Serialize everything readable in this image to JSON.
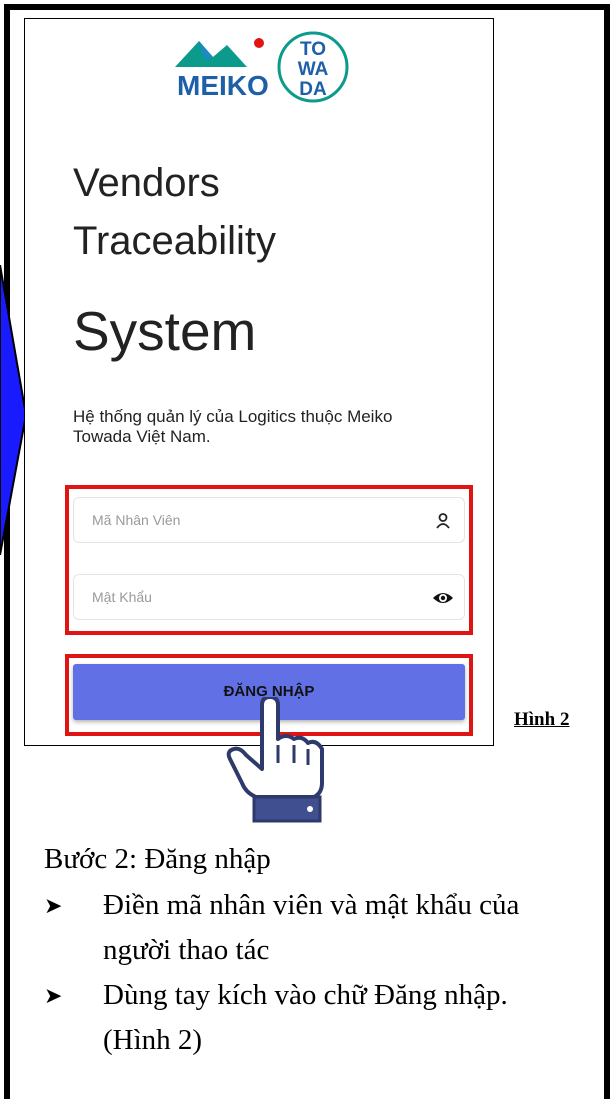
{
  "logo": {
    "brand_text": "MEIKO",
    "circle_text": [
      "TO",
      "WA",
      "DA"
    ]
  },
  "app": {
    "title_line1": "Vendors",
    "title_line2": "Traceability",
    "title_line3": "System",
    "description": "Hệ thống quản lý của Logitics thuộc Meiko Towada Việt Nam."
  },
  "form": {
    "employee_id_placeholder": "Mã Nhân Viên",
    "password_placeholder": "Mật Khẩu",
    "login_label": "ĐĂNG NHẬP"
  },
  "icons": {
    "user": "user-icon",
    "eye": "eye-icon",
    "hand": "pointing-hand-icon",
    "arrow": "arrow-icon"
  },
  "colors": {
    "button": "#6270e6",
    "highlight": "#e11414",
    "arrow": "#1a1aff"
  },
  "figure_label": "Hình 2",
  "instructions": {
    "step_title": "Bước 2: Đăng nhập",
    "bullets": [
      "Điền mã nhân viên và mật khẩu của người thao tác",
      "Dùng tay kích vào chữ Đăng nhập. (Hình 2)"
    ]
  }
}
